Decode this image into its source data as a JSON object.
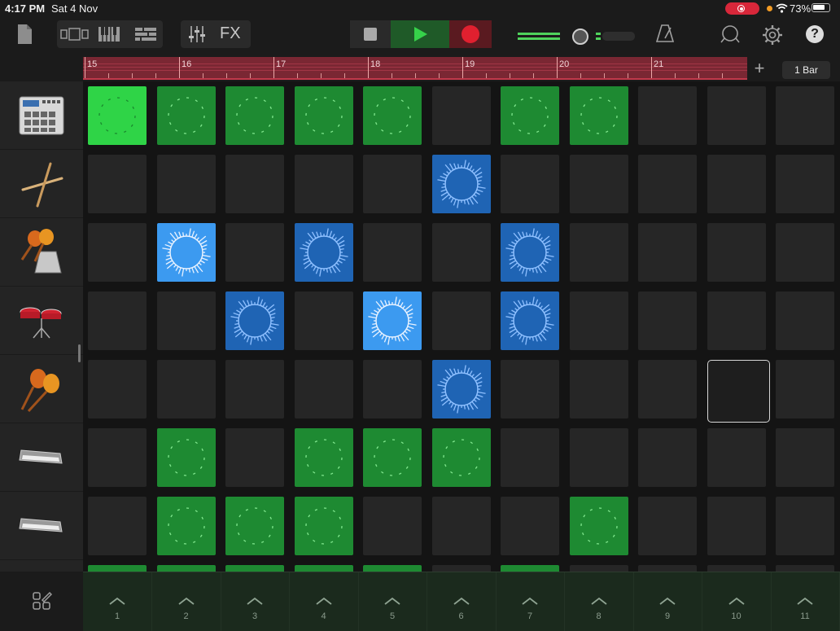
{
  "status": {
    "time": "4:17 PM",
    "date": "Sat 4 Nov",
    "battery": "73%"
  },
  "toolbar": {
    "fx_label": "FX",
    "icons": [
      "document-icon",
      "view-toggle-icon",
      "keyboard-icon",
      "tracks-icon",
      "mixer-icon",
      "stop-icon",
      "play-icon",
      "record-icon",
      "volume-slider",
      "metronome-icon",
      "loop-icon",
      "settings-icon",
      "help-icon"
    ],
    "help_label": "?"
  },
  "ruler": {
    "bars": [
      "15",
      "16",
      "17",
      "18",
      "19",
      "20",
      "21"
    ],
    "add_label": "+",
    "bar_button": "1 Bar"
  },
  "instruments": [
    {
      "name": "beat-machine"
    },
    {
      "name": "drumsticks"
    },
    {
      "name": "maracas-cowbell"
    },
    {
      "name": "drum-kit"
    },
    {
      "name": "maracas"
    },
    {
      "name": "keyboard-synth"
    },
    {
      "name": "keyboard-synth"
    }
  ],
  "grid": {
    "rows": [
      [
        "gb",
        "g",
        "g",
        "g",
        "g",
        "",
        "g",
        "g",
        "",
        "",
        ""
      ],
      [
        "",
        "",
        "",
        "",
        "",
        "b",
        "",
        "",
        "",
        "",
        ""
      ],
      [
        "",
        "bb",
        "",
        "b",
        "",
        "",
        "b",
        "",
        "",
        "",
        ""
      ],
      [
        "",
        "",
        "b",
        "",
        "bb",
        "",
        "b",
        "",
        "",
        "",
        ""
      ],
      [
        "",
        "",
        "",
        "",
        "",
        "b",
        "",
        "",
        "",
        "sel",
        ""
      ],
      [
        "",
        "g",
        "",
        "g",
        "g",
        "g",
        "",
        "",
        "",
        "",
        ""
      ],
      [
        "",
        "g",
        "g",
        "g",
        "",
        "",
        "",
        "g",
        "",
        "",
        ""
      ],
      [
        "g",
        "g",
        "g",
        "g",
        "g",
        "",
        "g",
        "",
        "",
        "",
        ""
      ]
    ]
  },
  "triggers": [
    "1",
    "2",
    "3",
    "4",
    "5",
    "6",
    "7",
    "8",
    "9",
    "10",
    "11"
  ],
  "colors": {
    "green": "#1e8a32",
    "green_bright": "#2fd447",
    "blue": "#1f64b4",
    "blue_bright": "#3c9af0",
    "ruler": "#7a2733",
    "record": "#e0202f"
  }
}
